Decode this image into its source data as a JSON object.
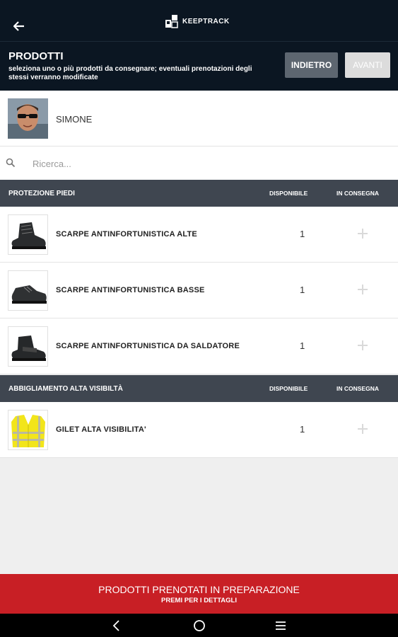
{
  "app": {
    "brand": "KEEPTRACK"
  },
  "header": {
    "title": "PRODOTTI",
    "subtitle": "seleziona uno o più prodotti da consegnare; eventuali prenotazioni degli stessi verranno modificate",
    "back_label": "INDIETRO",
    "next_label": "AVANTI"
  },
  "user": {
    "name": "SIMONE"
  },
  "search": {
    "placeholder": "Ricerca...",
    "value": ""
  },
  "sections": [
    {
      "title": "PROTEZIONE PIEDI",
      "col_available": "DISPONIBILE",
      "col_delivery": "IN CONSEGNA",
      "items": [
        {
          "name": "SCARPE ANTINFORTUNISTICA ALTE",
          "available": "1",
          "icon": "safety-boot-high-icon"
        },
        {
          "name": "SCARPE ANTINFORTUNISTICA BASSE",
          "available": "1",
          "icon": "safety-shoe-low-icon"
        },
        {
          "name": "SCARPE ANTINFORTUNISTICA DA SALDATORE",
          "available": "1",
          "icon": "welder-boot-icon"
        }
      ]
    },
    {
      "title": "ABBIGLIAMENTO ALTA VISIBILTÀ",
      "col_available": "DISPONIBILE",
      "col_delivery": "IN CONSEGNA",
      "items": [
        {
          "name": "GILET ALTA VISIBILITA'",
          "available": "1",
          "icon": "hi-vis-vest-icon"
        }
      ]
    }
  ],
  "banner": {
    "title": "PRODOTTI PRENOTATI IN PREPARAZIONE",
    "subtitle": "PREMI PER I DETTAGLI"
  },
  "colors": {
    "appbar": "#0b1622",
    "section": "#3f4650",
    "banner": "#c81f25",
    "vest": "#f2e51a"
  }
}
